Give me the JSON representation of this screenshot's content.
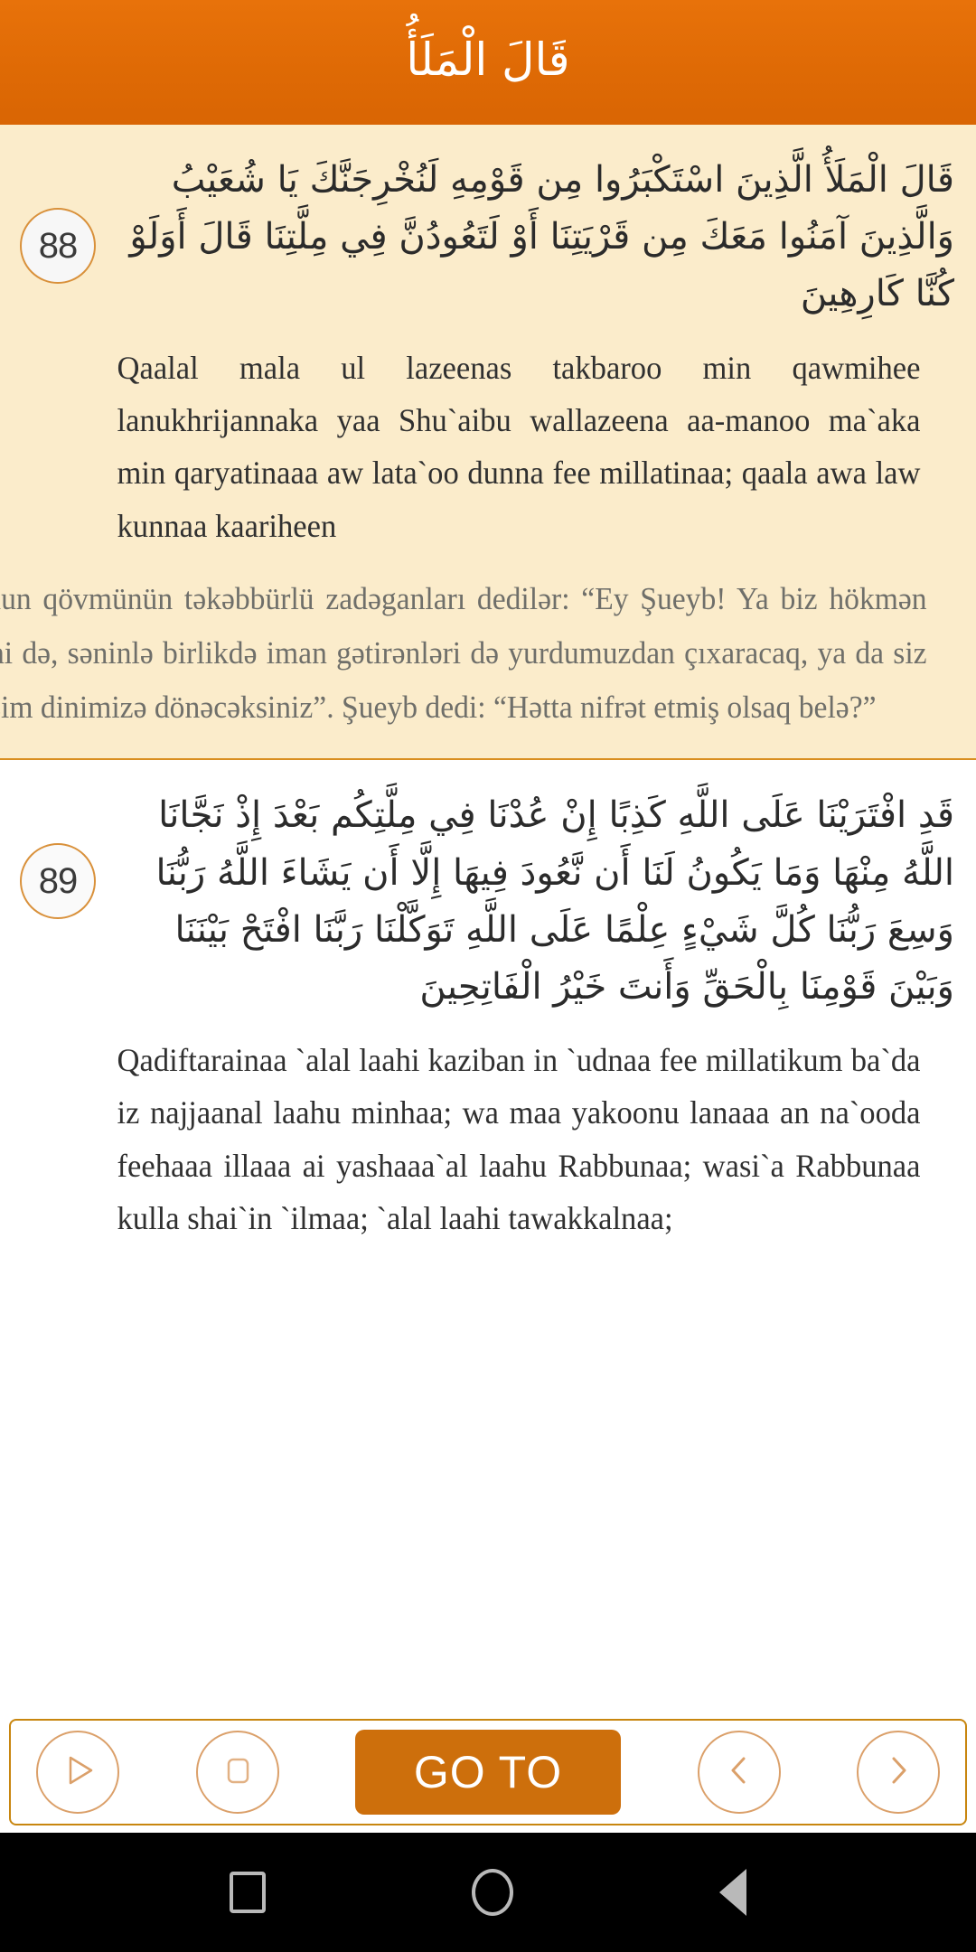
{
  "header": {
    "title": "قَالَ الْمَلَأُ",
    "background_color": "#df6a05"
  },
  "theme": {
    "accent": "#cd6f0c",
    "header_orange": "#df6a05",
    "cream_background": "#fbeccb",
    "white_background": "#ffffff",
    "badge_border": "#d9913b",
    "toolbar_border": "#c8860f",
    "translation_text": "#6f6f6a"
  },
  "verses": [
    {
      "number": "88",
      "arabic": "قَالَ الْمَلَأُ الَّذِينَ اسْتَكْبَرُوا مِن قَوْمِهِ لَنُخْرِجَنَّكَ يَا شُعَيْبُ وَالَّذِينَ آمَنُوا مَعَكَ مِن قَرْيَتِنَا أَوْ لَتَعُودُنَّ فِي مِلَّتِنَا قَالَ أَوَلَوْ كُنَّا كَارِهِينَ",
      "transliteration": "Qaalal mala ul lazeenas takbaroo min qawmihee lanukhrijannaka yaa Shu`aibu wallazeena aa-manoo ma`aka min qaryatinaaa aw lata`oo dunna fee millatinaa; qaala awa law kunnaa kaariheen",
      "translation": "Onun qövmünün təkəbbürlü zadəganları dedilər: “Ey Şueyb! Ya biz hökmən səni də, səninlə birlikdə iman gətirənləri də yurdumuzdan çıxaracaq, ya da siz bizim dinimizə dönəcəksiniz”. Şueyb dedi: “Hətta nifrət etmiş olsaq belə?”",
      "background": "cream"
    },
    {
      "number": "89",
      "arabic": "قَدِ افْتَرَيْنَا عَلَى اللَّهِ كَذِبًا إِنْ عُدْنَا فِي مِلَّتِكُم بَعْدَ إِذْ نَجَّانَا اللَّهُ مِنْهَا وَمَا يَكُونُ لَنَا أَن نَّعُودَ فِيهَا إِلَّا أَن يَشَاءَ اللَّهُ رَبُّنَا وَسِعَ رَبُّنَا كُلَّ شَيْءٍ عِلْمًا عَلَى اللَّهِ تَوَكَّلْنَا رَبَّنَا افْتَحْ بَيْنَنَا وَبَيْنَ قَوْمِنَا بِالْحَقِّ وَأَنتَ خَيْرُ الْفَاتِحِينَ",
      "transliteration": "Qadiftarainaa `alal laahi kaziban in `udnaa fee millatikum ba`da iz najjaanal laahu minhaa; wa maa yakoonu lanaaa an na`ooda feehaaa illaaa ai yashaaa`al laahu Rabbunaa; wasi`a Rabbunaa kulla shai`in `ilmaa; `alal laahi tawakkalnaa;",
      "translation": "",
      "background": "white"
    }
  ],
  "toolbar": {
    "play_label": "play-icon",
    "stop_label": "stop-icon",
    "goto_label": "GO TO",
    "prev_label": "chevron-left-icon",
    "next_label": "chevron-right-icon"
  },
  "navbar": {
    "recents": "square-icon",
    "home": "circle-icon",
    "back": "back-triangle-icon"
  }
}
